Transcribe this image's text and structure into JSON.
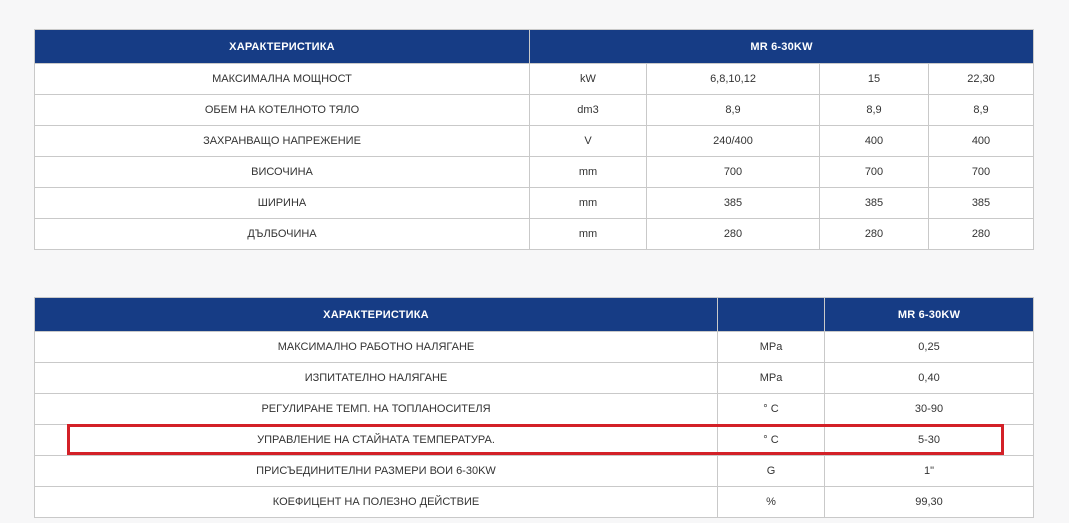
{
  "table1": {
    "headers": [
      "ХАРАКТЕРИСТИКА",
      "MR 6-30KW"
    ],
    "rows": [
      [
        "МАКСИМАЛНА МОЩНОСТ",
        "kW",
        "6,8,10,12",
        "15",
        "22,30"
      ],
      [
        "ОБЕМ НА КОТЕЛНОТО ТЯЛО",
        "dm3",
        "8,9",
        "8,9",
        "8,9"
      ],
      [
        "ЗАХРАНВАЩО НАПРЕЖЕНИЕ",
        "V",
        "240/400",
        "400",
        "400"
      ],
      [
        "ВИСОЧИНА",
        "mm",
        "700",
        "700",
        "700"
      ],
      [
        "ШИРИНА",
        "mm",
        "385",
        "385",
        "385"
      ],
      [
        "ДЪЛБОЧИНА",
        "mm",
        "280",
        "280",
        "280"
      ]
    ]
  },
  "table2": {
    "headers": [
      "ХАРАКТЕРИСТИКА",
      "",
      "MR 6-30KW"
    ],
    "rows": [
      [
        "МАКСИМАЛНО РАБОТНО НАЛЯГАНЕ",
        "MPa",
        "0,25"
      ],
      [
        "ИЗПИТАТЕЛНО НАЛЯГАНЕ",
        "MPa",
        "0,40"
      ],
      [
        "РЕГУЛИРАНЕ ТЕМП. НА ТОПЛАНОСИТЕЛЯ",
        "° C",
        "30-90"
      ],
      [
        "УПРАВЛЕНИЕ НА СТАЙНАТА ТЕМПЕРАТУРА.",
        "° C",
        "5-30"
      ],
      [
        "ПРИСЪЕДИНИТЕЛНИ РАЗМЕРИ ВОИ 6-30KW",
        "G",
        "1\""
      ],
      [
        "КОЕФИЦЕНТ НА ПОЛЕЗНО ДЕЙСТВИЕ",
        "%",
        "99,30"
      ]
    ]
  },
  "colors": {
    "header_bg": "#163c85",
    "header_text": "#ffffff",
    "border": "#c9c9c9",
    "highlight": "#d32027"
  }
}
